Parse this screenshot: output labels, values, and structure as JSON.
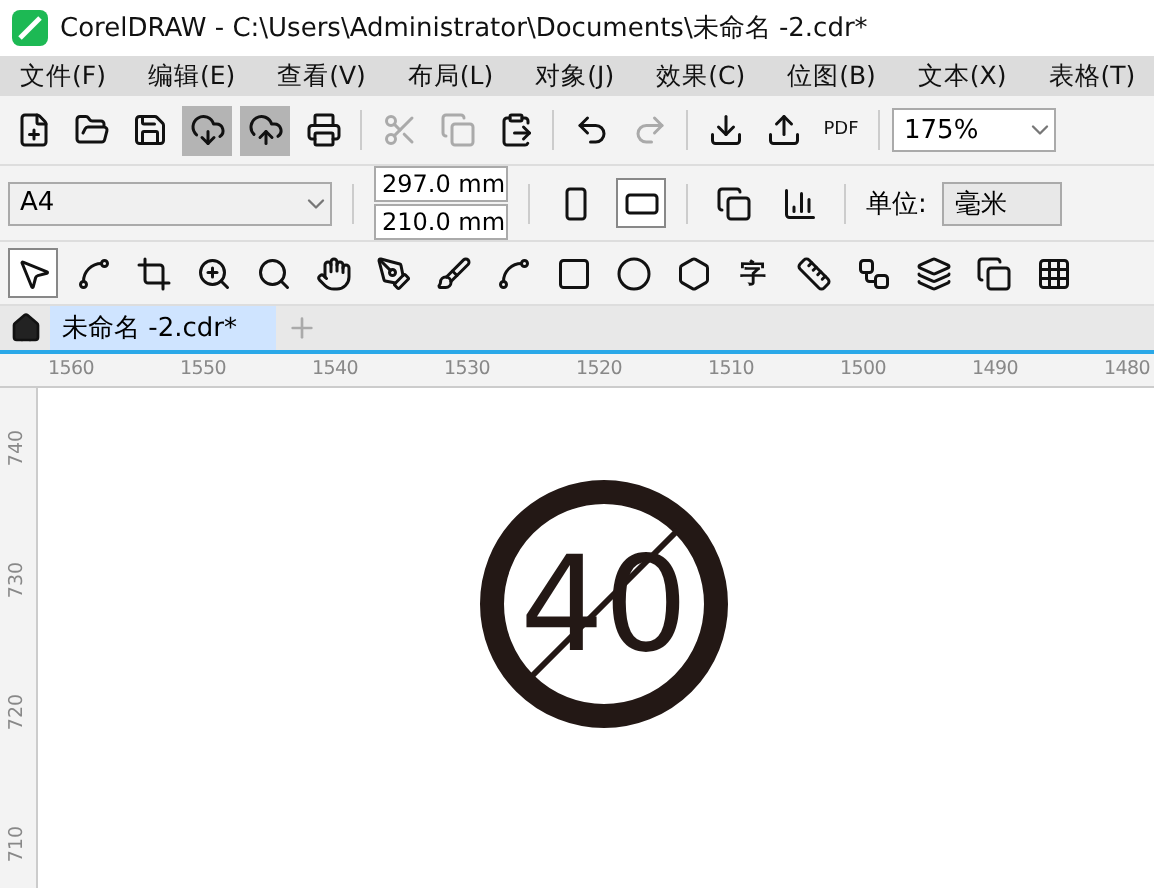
{
  "window": {
    "title": "CorelDRAW - C:\\Users\\Administrator\\Documents\\未命名 -2.cdr*"
  },
  "menu": [
    "文件(F)",
    "编辑(E)",
    "查看(V)",
    "布局(L)",
    "对象(J)",
    "效果(C)",
    "位图(B)",
    "文本(X)",
    "表格(T)"
  ],
  "main_toolbar": {
    "buttons": [
      {
        "kind": "new",
        "pressed": false,
        "disabled": false
      },
      {
        "kind": "open",
        "pressed": false,
        "disabled": false
      },
      {
        "kind": "save",
        "pressed": false,
        "disabled": false
      },
      {
        "kind": "cloud-down",
        "pressed": true,
        "disabled": false
      },
      {
        "kind": "cloud-up",
        "pressed": true,
        "disabled": false
      },
      {
        "kind": "print",
        "pressed": false,
        "disabled": false
      },
      {
        "kind": "cut",
        "pressed": false,
        "disabled": true
      },
      {
        "kind": "copy",
        "pressed": false,
        "disabled": true
      },
      {
        "kind": "paste",
        "pressed": false,
        "disabled": false
      },
      {
        "kind": "undo",
        "pressed": false,
        "disabled": false
      },
      {
        "kind": "redo",
        "pressed": false,
        "disabled": true
      },
      {
        "kind": "import",
        "pressed": false,
        "disabled": false
      },
      {
        "kind": "export",
        "pressed": false,
        "disabled": false
      },
      {
        "kind": "pdf",
        "label": "PDF",
        "pressed": false,
        "disabled": false
      }
    ],
    "zoom": "175%"
  },
  "property_bar": {
    "page_size": "A4",
    "width": "297.0 mm",
    "height": "210.0 mm",
    "landscape": true,
    "unit_label": "单位:",
    "unit": "毫米"
  },
  "toolbox": [
    {
      "kind": "pick",
      "selected": true
    },
    {
      "kind": "shape",
      "selected": false
    },
    {
      "kind": "crop",
      "selected": false
    },
    {
      "kind": "zoom",
      "selected": false
    },
    {
      "kind": "zoom2",
      "selected": false
    },
    {
      "kind": "pan",
      "selected": false
    },
    {
      "kind": "curve",
      "selected": false
    },
    {
      "kind": "brush",
      "selected": false
    },
    {
      "kind": "hook",
      "selected": false
    },
    {
      "kind": "rect",
      "selected": false
    },
    {
      "kind": "ellipse",
      "selected": false
    },
    {
      "kind": "polygon",
      "selected": false
    },
    {
      "kind": "text",
      "label": "字",
      "selected": false
    },
    {
      "kind": "dimension",
      "selected": false
    },
    {
      "kind": "connector",
      "selected": false
    },
    {
      "kind": "blend",
      "selected": false
    },
    {
      "kind": "shadow",
      "selected": false
    },
    {
      "kind": "transparency",
      "selected": false
    }
  ],
  "document_tabs": [
    {
      "label": "未命名 -2.cdr*",
      "selected": true
    }
  ],
  "ruler": {
    "x_labels": [
      "1560",
      "1550",
      "1540",
      "1530",
      "1520",
      "1510",
      "1500",
      "1490",
      "1480"
    ],
    "y_labels": [
      "740",
      "730",
      "720",
      "710"
    ]
  },
  "drawing": {
    "sign_text": "40"
  }
}
